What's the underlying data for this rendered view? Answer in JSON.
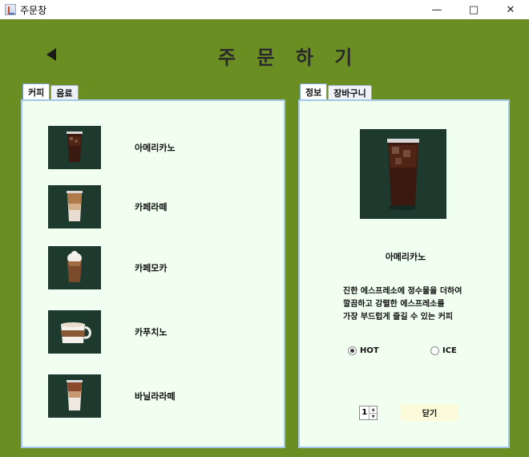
{
  "window": {
    "title": "주문창",
    "minimize_icon": "minimize-icon",
    "maximize_icon": "maximize-icon",
    "close_icon": "close-icon"
  },
  "header": {
    "title": "주 문 하 기",
    "back_icon": "back-arrow-icon"
  },
  "menu": {
    "tabs": [
      {
        "label": "커피",
        "active": true
      },
      {
        "label": "음료",
        "active": false
      }
    ],
    "items": [
      {
        "name": "아메리카노",
        "image": "iced-americano"
      },
      {
        "name": "카페라떼",
        "image": "iced-cafe-latte"
      },
      {
        "name": "카페모카",
        "image": "cafe-mocha-whipped"
      },
      {
        "name": "카푸치노",
        "image": "cappuccino-cup"
      },
      {
        "name": "바닐라라떼",
        "image": "iced-vanilla-latte"
      }
    ]
  },
  "detail": {
    "tabs": [
      {
        "label": "정보",
        "active": true
      },
      {
        "label": "장바구니",
        "active": false
      }
    ],
    "image": "iced-americano",
    "name": "아메리카노",
    "description": [
      "진한 에스프레소에 정수물을 더하여",
      "깔끔하고 강렬한 에스프레소를",
      "가장 부드럽게 즐길 수 있는 커피"
    ],
    "options": [
      {
        "label": "HOT",
        "selected": true
      },
      {
        "label": "ICE",
        "selected": false
      }
    ],
    "quantity": "1",
    "close_label": "닫기"
  },
  "colors": {
    "background": "#6b8e23",
    "panel": "#f0fff0",
    "panel_border": "#a6c8e8",
    "thumb_bg": "#1e3a2e",
    "button": "#fbfbdc"
  }
}
